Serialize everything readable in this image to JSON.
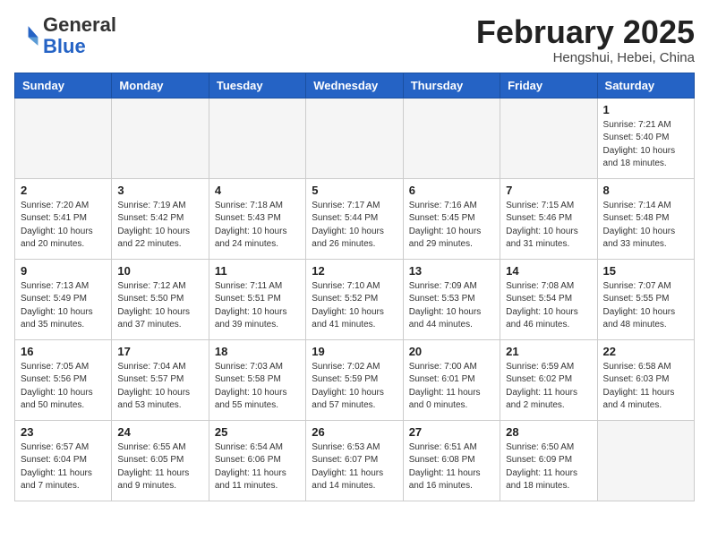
{
  "header": {
    "logo_general": "General",
    "logo_blue": "Blue",
    "month_title": "February 2025",
    "subtitle": "Hengshui, Hebei, China"
  },
  "weekdays": [
    "Sunday",
    "Monday",
    "Tuesday",
    "Wednesday",
    "Thursday",
    "Friday",
    "Saturday"
  ],
  "weeks": [
    [
      {
        "day": "",
        "info": ""
      },
      {
        "day": "",
        "info": ""
      },
      {
        "day": "",
        "info": ""
      },
      {
        "day": "",
        "info": ""
      },
      {
        "day": "",
        "info": ""
      },
      {
        "day": "",
        "info": ""
      },
      {
        "day": "1",
        "info": "Sunrise: 7:21 AM\nSunset: 5:40 PM\nDaylight: 10 hours\nand 18 minutes."
      }
    ],
    [
      {
        "day": "2",
        "info": "Sunrise: 7:20 AM\nSunset: 5:41 PM\nDaylight: 10 hours\nand 20 minutes."
      },
      {
        "day": "3",
        "info": "Sunrise: 7:19 AM\nSunset: 5:42 PM\nDaylight: 10 hours\nand 22 minutes."
      },
      {
        "day": "4",
        "info": "Sunrise: 7:18 AM\nSunset: 5:43 PM\nDaylight: 10 hours\nand 24 minutes."
      },
      {
        "day": "5",
        "info": "Sunrise: 7:17 AM\nSunset: 5:44 PM\nDaylight: 10 hours\nand 26 minutes."
      },
      {
        "day": "6",
        "info": "Sunrise: 7:16 AM\nSunset: 5:45 PM\nDaylight: 10 hours\nand 29 minutes."
      },
      {
        "day": "7",
        "info": "Sunrise: 7:15 AM\nSunset: 5:46 PM\nDaylight: 10 hours\nand 31 minutes."
      },
      {
        "day": "8",
        "info": "Sunrise: 7:14 AM\nSunset: 5:48 PM\nDaylight: 10 hours\nand 33 minutes."
      }
    ],
    [
      {
        "day": "9",
        "info": "Sunrise: 7:13 AM\nSunset: 5:49 PM\nDaylight: 10 hours\nand 35 minutes."
      },
      {
        "day": "10",
        "info": "Sunrise: 7:12 AM\nSunset: 5:50 PM\nDaylight: 10 hours\nand 37 minutes."
      },
      {
        "day": "11",
        "info": "Sunrise: 7:11 AM\nSunset: 5:51 PM\nDaylight: 10 hours\nand 39 minutes."
      },
      {
        "day": "12",
        "info": "Sunrise: 7:10 AM\nSunset: 5:52 PM\nDaylight: 10 hours\nand 41 minutes."
      },
      {
        "day": "13",
        "info": "Sunrise: 7:09 AM\nSunset: 5:53 PM\nDaylight: 10 hours\nand 44 minutes."
      },
      {
        "day": "14",
        "info": "Sunrise: 7:08 AM\nSunset: 5:54 PM\nDaylight: 10 hours\nand 46 minutes."
      },
      {
        "day": "15",
        "info": "Sunrise: 7:07 AM\nSunset: 5:55 PM\nDaylight: 10 hours\nand 48 minutes."
      }
    ],
    [
      {
        "day": "16",
        "info": "Sunrise: 7:05 AM\nSunset: 5:56 PM\nDaylight: 10 hours\nand 50 minutes."
      },
      {
        "day": "17",
        "info": "Sunrise: 7:04 AM\nSunset: 5:57 PM\nDaylight: 10 hours\nand 53 minutes."
      },
      {
        "day": "18",
        "info": "Sunrise: 7:03 AM\nSunset: 5:58 PM\nDaylight: 10 hours\nand 55 minutes."
      },
      {
        "day": "19",
        "info": "Sunrise: 7:02 AM\nSunset: 5:59 PM\nDaylight: 10 hours\nand 57 minutes."
      },
      {
        "day": "20",
        "info": "Sunrise: 7:00 AM\nSunset: 6:01 PM\nDaylight: 11 hours\nand 0 minutes."
      },
      {
        "day": "21",
        "info": "Sunrise: 6:59 AM\nSunset: 6:02 PM\nDaylight: 11 hours\nand 2 minutes."
      },
      {
        "day": "22",
        "info": "Sunrise: 6:58 AM\nSunset: 6:03 PM\nDaylight: 11 hours\nand 4 minutes."
      }
    ],
    [
      {
        "day": "23",
        "info": "Sunrise: 6:57 AM\nSunset: 6:04 PM\nDaylight: 11 hours\nand 7 minutes."
      },
      {
        "day": "24",
        "info": "Sunrise: 6:55 AM\nSunset: 6:05 PM\nDaylight: 11 hours\nand 9 minutes."
      },
      {
        "day": "25",
        "info": "Sunrise: 6:54 AM\nSunset: 6:06 PM\nDaylight: 11 hours\nand 11 minutes."
      },
      {
        "day": "26",
        "info": "Sunrise: 6:53 AM\nSunset: 6:07 PM\nDaylight: 11 hours\nand 14 minutes."
      },
      {
        "day": "27",
        "info": "Sunrise: 6:51 AM\nSunset: 6:08 PM\nDaylight: 11 hours\nand 16 minutes."
      },
      {
        "day": "28",
        "info": "Sunrise: 6:50 AM\nSunset: 6:09 PM\nDaylight: 11 hours\nand 18 minutes."
      },
      {
        "day": "",
        "info": ""
      }
    ]
  ]
}
